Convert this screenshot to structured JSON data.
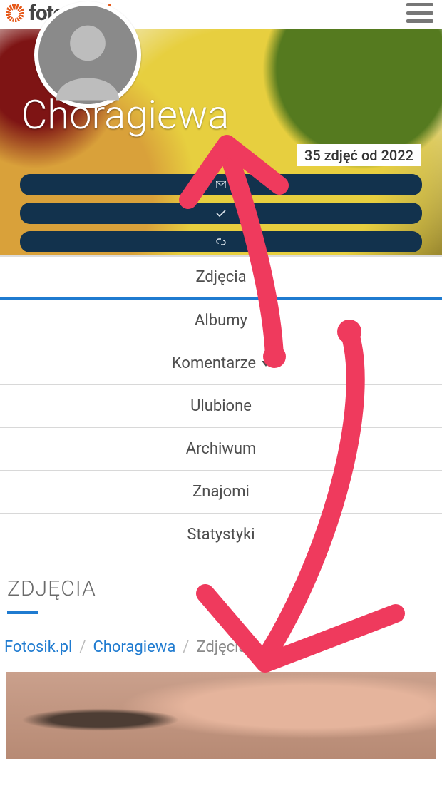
{
  "header": {
    "logo_word": "fotosik",
    "logo_ext": ".pl"
  },
  "profile": {
    "username": "Choragiewa",
    "stats_badge": "35 zdjęć od 2022"
  },
  "action_pills": [
    {
      "name": "message",
      "icon": "envelope"
    },
    {
      "name": "follow",
      "icon": "check"
    },
    {
      "name": "more",
      "icon": "link"
    }
  ],
  "tabs": [
    {
      "label": "Zdjęcia",
      "active": true,
      "has_caret": false
    },
    {
      "label": "Albumy",
      "active": false,
      "has_caret": false
    },
    {
      "label": "Komentarze",
      "active": false,
      "has_caret": true
    },
    {
      "label": "Ulubione",
      "active": false,
      "has_caret": false
    },
    {
      "label": "Archiwum",
      "active": false,
      "has_caret": false
    },
    {
      "label": "Znajomi",
      "active": false,
      "has_caret": false
    },
    {
      "label": "Statystyki",
      "active": false,
      "has_caret": false
    }
  ],
  "section": {
    "heading": "ZDJĘCIA"
  },
  "breadcrumbs": {
    "items": [
      {
        "label": "Fotosik.pl",
        "link": true
      },
      {
        "label": "Choragiewa",
        "link": true
      },
      {
        "label": "Zdjęcia",
        "link": false
      }
    ],
    "sep": "/"
  },
  "annotation": {
    "color": "#ef3a5d",
    "description": "Two hand-drawn red arrows connecting the profile action buttons to the breadcrumb area"
  }
}
